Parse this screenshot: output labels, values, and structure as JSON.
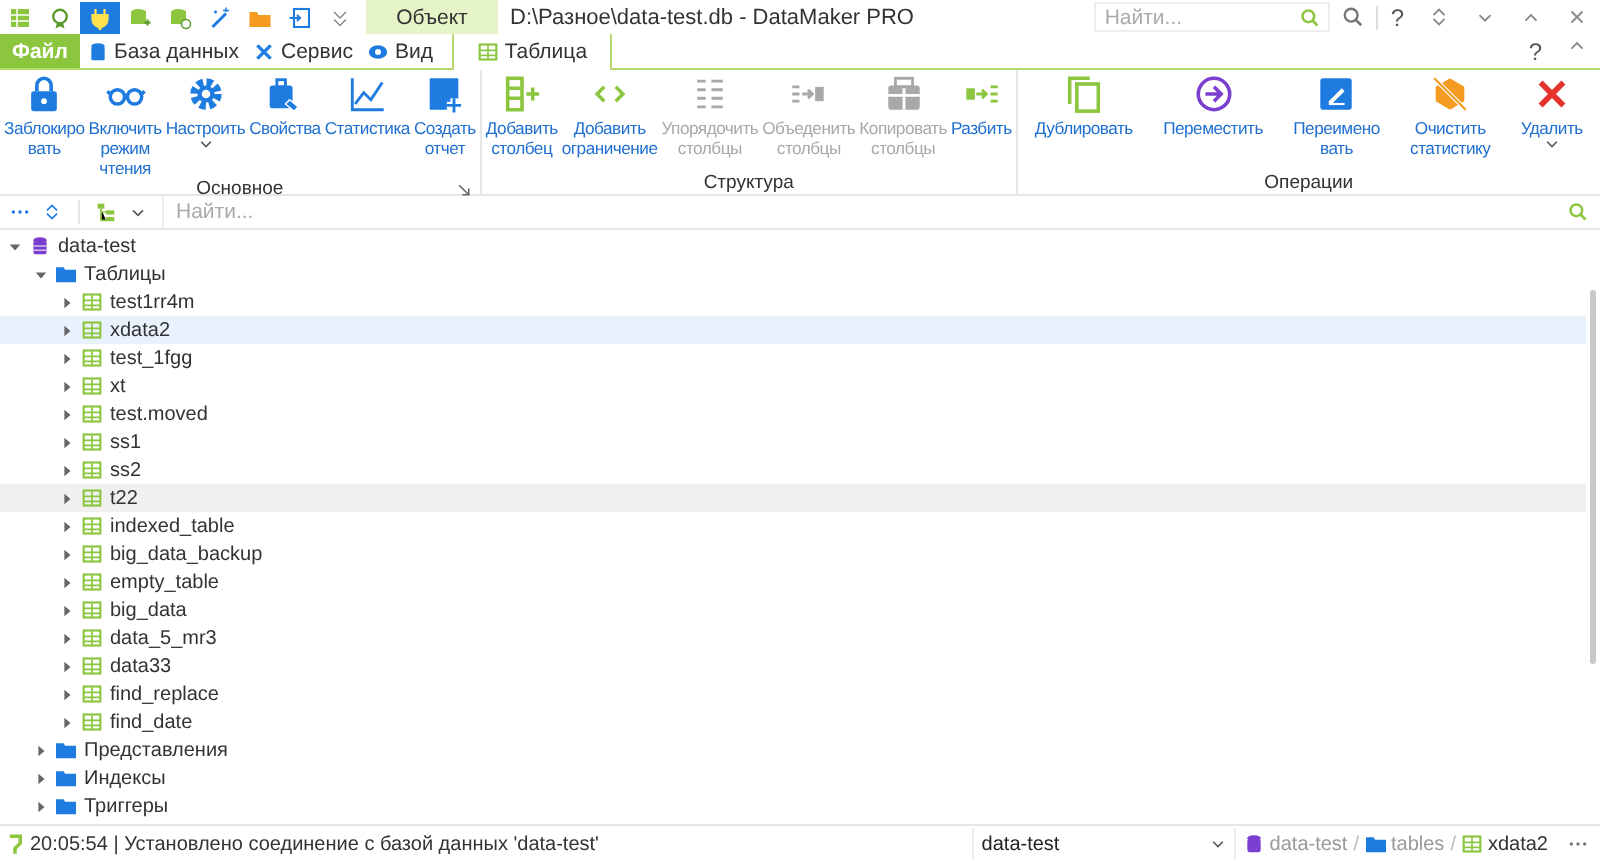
{
  "window": {
    "title": "D:\\Разное\\data-test.db - DataMaker PRO",
    "context_tab_group": "Объект",
    "search": {
      "placeholder": "Найти..."
    },
    "help": "?"
  },
  "tabs": [
    {
      "label": "Файл",
      "selected": false,
      "kind": "file"
    },
    {
      "label": "База данных",
      "selected": false,
      "kind": "normal"
    },
    {
      "label": "Сервис",
      "selected": false,
      "kind": "normal"
    },
    {
      "label": "Вид",
      "selected": false,
      "kind": "normal"
    },
    {
      "label": "Таблица",
      "selected": true,
      "kind": "context"
    }
  ],
  "ribbon_help": "?",
  "ribbon": [
    {
      "label": "Основное",
      "launcher": true,
      "buttons": [
        {
          "lines": [
            "Заблокиро",
            "вать"
          ],
          "disabled": false,
          "dropdown": false
        },
        {
          "lines": [
            "Включить",
            "режим",
            "чтения"
          ],
          "disabled": false,
          "dropdown": false
        },
        {
          "lines": [
            "Настроить"
          ],
          "disabled": false,
          "dropdown": true
        },
        {
          "lines": [
            "Свойства"
          ],
          "disabled": false,
          "dropdown": false
        },
        {
          "lines": [
            "Статистика"
          ],
          "disabled": false,
          "dropdown": false
        },
        {
          "lines": [
            "Создать",
            "отчет"
          ],
          "disabled": false,
          "dropdown": false
        }
      ]
    },
    {
      "label": "Структура",
      "launcher": false,
      "buttons": [
        {
          "lines": [
            "Добавить",
            "столбец"
          ],
          "disabled": false,
          "dropdown": false
        },
        {
          "lines": [
            "Добавить",
            "ограничение"
          ],
          "disabled": false,
          "dropdown": false
        },
        {
          "lines": [
            "Упорядочить",
            "столбцы"
          ],
          "disabled": true,
          "dropdown": false
        },
        {
          "lines": [
            "Объеденить",
            "столбцы"
          ],
          "disabled": true,
          "dropdown": false
        },
        {
          "lines": [
            "Копировать",
            "столбцы"
          ],
          "disabled": true,
          "dropdown": false
        },
        {
          "lines": [
            "Разбить"
          ],
          "disabled": false,
          "dropdown": false
        }
      ]
    },
    {
      "label": "Операции",
      "launcher": false,
      "buttons": [
        {
          "lines": [
            "Дублировать"
          ],
          "disabled": false,
          "dropdown": false
        },
        {
          "lines": [
            "Переместить"
          ],
          "disabled": false,
          "dropdown": false
        },
        {
          "lines": [
            "Переимено",
            "вать"
          ],
          "disabled": false,
          "dropdown": false
        },
        {
          "lines": [
            "Очистить",
            "статистику"
          ],
          "disabled": false,
          "dropdown": false
        },
        {
          "lines": [
            "Удалить"
          ],
          "disabled": false,
          "dropdown": true
        }
      ]
    }
  ],
  "filter": {
    "placeholder": "Найти..."
  },
  "tree": [
    {
      "label": "data-test",
      "kind": "database",
      "expanded": true,
      "selected": false,
      "children": [
        {
          "label": "Таблицы",
          "kind": "folder",
          "expanded": true,
          "selected": false,
          "children": [
            {
              "label": "test1rr4m",
              "kind": "table",
              "expanded": false,
              "selected": false
            },
            {
              "label": "xdata2",
              "kind": "table",
              "expanded": false,
              "selected": true
            },
            {
              "label": "test_1fgg",
              "kind": "table",
              "expanded": false,
              "selected": false
            },
            {
              "label": "xt",
              "kind": "table",
              "expanded": false,
              "selected": false
            },
            {
              "label": "test.moved",
              "kind": "table",
              "expanded": false,
              "selected": false
            },
            {
              "label": "ss1",
              "kind": "table",
              "expanded": false,
              "selected": false
            },
            {
              "label": "ss2",
              "kind": "table",
              "expanded": false,
              "selected": false
            },
            {
              "label": "t22",
              "kind": "table",
              "expanded": false,
              "selected": false,
              "hovered": true
            },
            {
              "label": "indexed_table",
              "kind": "table",
              "expanded": false,
              "selected": false
            },
            {
              "label": "big_data_backup",
              "kind": "table",
              "expanded": false,
              "selected": false
            },
            {
              "label": "empty_table",
              "kind": "table",
              "expanded": false,
              "selected": false
            },
            {
              "label": "big_data",
              "kind": "table",
              "expanded": false,
              "selected": false
            },
            {
              "label": "data_5_mr3",
              "kind": "table",
              "expanded": false,
              "selected": false
            },
            {
              "label": "data33",
              "kind": "table",
              "expanded": false,
              "selected": false
            },
            {
              "label": "find_replace",
              "kind": "table",
              "expanded": false,
              "selected": false
            },
            {
              "label": "find_date",
              "kind": "table",
              "expanded": false,
              "selected": false
            }
          ]
        },
        {
          "label": "Представления",
          "kind": "folder",
          "expanded": false,
          "selected": false
        },
        {
          "label": "Индексы",
          "kind": "folder",
          "expanded": false,
          "selected": false
        },
        {
          "label": "Триггеры",
          "kind": "folder",
          "expanded": false,
          "selected": false
        }
      ]
    }
  ],
  "status_bar": {
    "message": "20:05:54 | Установлено соединение с базой данных 'data-test'",
    "database": "data-test",
    "breadcrumb_separator": "/",
    "breadcrumb": [
      {
        "label": "data-test",
        "kind": "database"
      },
      {
        "label": "tables",
        "kind": "folder"
      },
      {
        "label": "xdata2",
        "kind": "table"
      }
    ]
  }
}
